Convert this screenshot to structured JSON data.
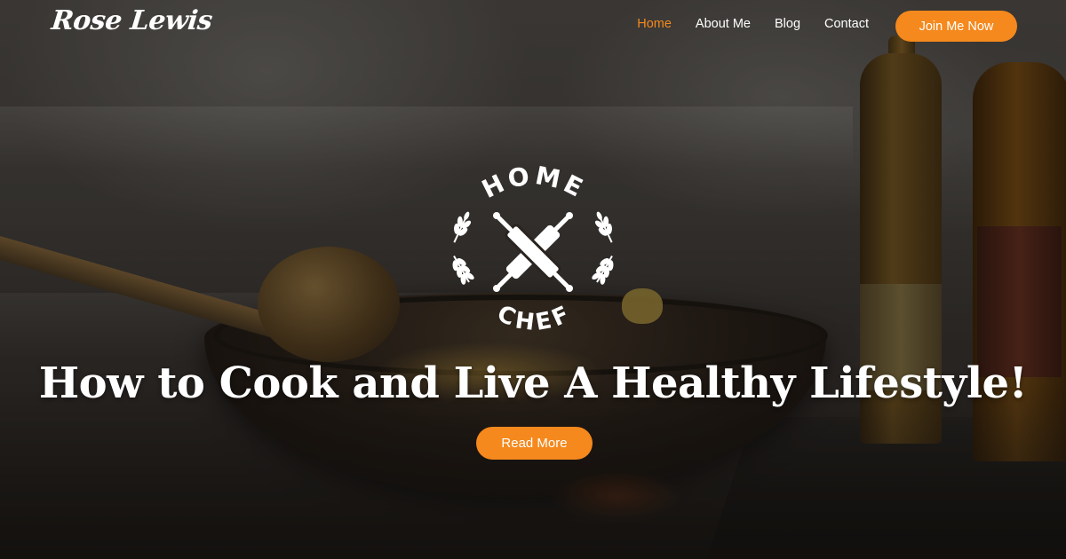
{
  "brand": {
    "name": "Rose Lewis"
  },
  "nav": {
    "items": [
      {
        "label": "Home",
        "active": true
      },
      {
        "label": "About Me",
        "active": false
      },
      {
        "label": "Blog",
        "active": false
      },
      {
        "label": "Contact",
        "active": false
      }
    ],
    "cta_label": "Join Me Now"
  },
  "hero": {
    "badge_top": "HOME",
    "badge_bottom": "CHEF",
    "badge_icon": "crossed-rolling-pins-icon",
    "title": "How to Cook and Live A Healthy Lifestyle!",
    "button_label": "Read More"
  },
  "colors": {
    "accent": "#f5891d",
    "text": "#ffffff"
  }
}
